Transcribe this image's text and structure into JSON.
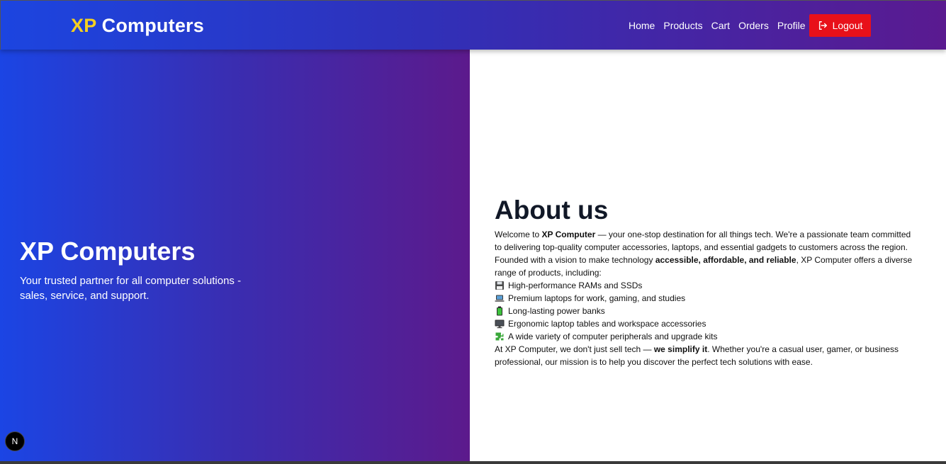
{
  "nav": {
    "brand_xp": "XP",
    "brand_rest": "Computers",
    "links": [
      "Home",
      "Products",
      "Cart",
      "Orders",
      "Profile"
    ],
    "logout_label": "Logout"
  },
  "hero": {
    "title": "XP Computers",
    "subtitle": "Your trusted partner for all computer solutions - sales, service, and support."
  },
  "about": {
    "title": "About us",
    "intro": {
      "p1": "Welcome to ",
      "p1_bold": "XP Computer",
      "p2": " — your one-stop destination for all things tech. We're a passionate team committed to delivering top-quality computer accessories, laptops, and essential gadgets to customers across the region. Founded with a vision to make technology ",
      "p2_bold": "accessible, affordable, and reliable",
      "p3": ", XP Computer offers a diverse range of products, including:"
    },
    "features": [
      {
        "icon": "floppy-disk-icon",
        "text": "High-performance RAMs and SSDs"
      },
      {
        "icon": "laptop-icon",
        "text": "Premium laptops for work, gaming, and studies"
      },
      {
        "icon": "battery-icon",
        "text": "Long-lasting power banks"
      },
      {
        "icon": "monitor-icon",
        "text": "Ergonomic laptop tables and workspace accessories"
      },
      {
        "icon": "puzzle-piece-icon",
        "text": "A wide variety of computer peripherals and upgrade kits"
      }
    ],
    "outro": {
      "p1": "At XP Computer, we don't just sell tech — ",
      "p1_bold": "we simplify it",
      "p2": ". Whether you're a casual user, gamer, or business professional, our mission is to help you discover the perfect tech solutions with ease."
    }
  },
  "dev_badge": "N",
  "colors": {
    "brand_yellow": "#f5d020",
    "logout_red": "#e8101a",
    "gradient_blue": "#1b45e4",
    "gradient_purple": "#5c1a8c"
  }
}
